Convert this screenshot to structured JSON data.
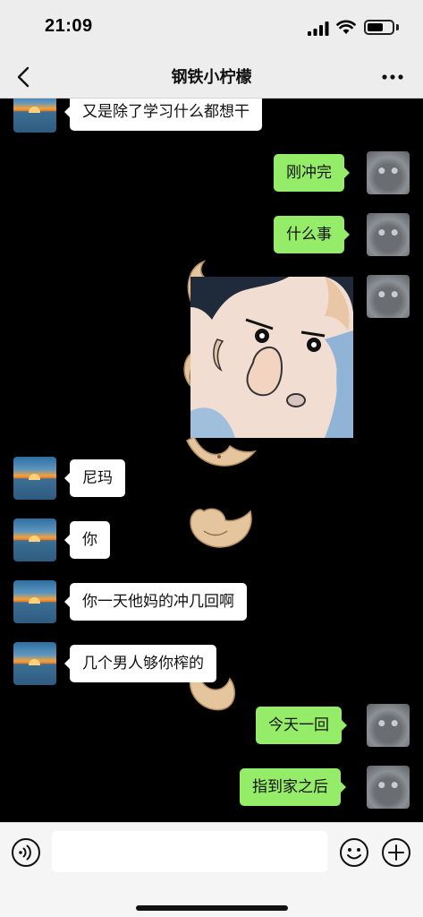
{
  "status_bar": {
    "time": "21:09"
  },
  "nav": {
    "title": "钢铁小柠檬"
  },
  "messages": [
    {
      "side": "in",
      "avatar": "sunset-avatar",
      "text": "又是除了学习什么都想干"
    },
    {
      "side": "out",
      "avatar": "cat-avatar",
      "text": "刚冲完"
    },
    {
      "side": "out",
      "avatar": "cat-avatar",
      "text": "什么事"
    },
    {
      "side": "out",
      "avatar": "cat-avatar",
      "type": "sticker",
      "sticker": "crayon-shin-chan-nose-pick-sticker"
    },
    {
      "side": "in",
      "avatar": "sunset-avatar",
      "text": "尼玛"
    },
    {
      "side": "in",
      "avatar": "sunset-avatar",
      "text": "你"
    },
    {
      "side": "in",
      "avatar": "sunset-avatar",
      "text": "你一天他妈的冲几回啊"
    },
    {
      "side": "in",
      "avatar": "sunset-avatar",
      "text": "几个男人够你榨的"
    },
    {
      "side": "out",
      "avatar": "cat-avatar",
      "text": "今天一回"
    },
    {
      "side": "out",
      "avatar": "cat-avatar",
      "text": "指到家之后"
    }
  ],
  "input_bar": {
    "placeholder": "",
    "icons": [
      "voice-icon",
      "emoji-icon",
      "plus-icon"
    ]
  },
  "colors": {
    "chat_background": "#000000",
    "outgoing_bubble": "#95ec69",
    "incoming_bubble": "#ffffff",
    "header_background": "#ededed"
  }
}
